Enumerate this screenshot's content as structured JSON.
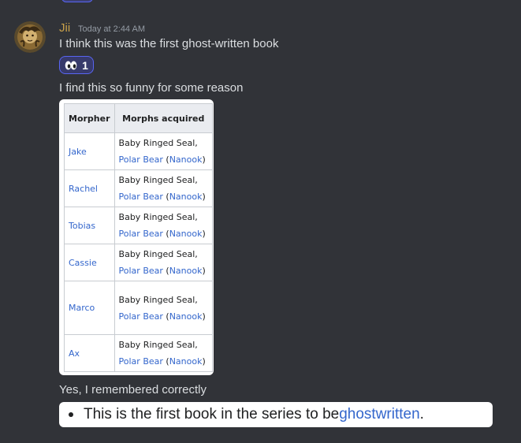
{
  "message": {
    "username": "Jii",
    "timestamp": "Today at 2:44 AM",
    "lines": {
      "first": "I think this was the first ghost-written book",
      "second": "I find this so funny for some reason",
      "third": "Yes, I remembered correctly"
    },
    "reaction": {
      "icon": "eyes-emoji-icon",
      "count": "1"
    }
  },
  "table": {
    "headers": [
      "Morpher",
      "Morphs acquired"
    ],
    "rows": [
      {
        "name": "Jake",
        "morph1": "Baby Ringed Seal,",
        "morph2_link": "Polar Bear",
        "open_paren": " (",
        "nick_link": "Nanook",
        "close_paren": ")"
      },
      {
        "name": "Rachel",
        "morph1": "Baby Ringed Seal,",
        "morph2_link": "Polar Bear",
        "open_paren": " (",
        "nick_link": "Nanook",
        "close_paren": ")"
      },
      {
        "name": "Tobias",
        "morph1": "Baby Ringed Seal,",
        "morph2_link": "Polar Bear",
        "open_paren": " (",
        "nick_link": "Nanook",
        "close_paren": ")"
      },
      {
        "name": "Cassie",
        "morph1": "Baby Ringed Seal,",
        "morph2_link": "Polar Bear",
        "open_paren": " (",
        "nick_link": "Nanook",
        "close_paren": ")"
      },
      {
        "name": "Marco",
        "morph1": "Baby Ringed Seal,",
        "morph2_link": "Polar Bear",
        "open_paren": " (",
        "nick_link": "Nanook",
        "close_paren": ")"
      },
      {
        "name": "Ax",
        "morph1": "Baby Ringed Seal,",
        "morph2_link": "Polar Bear",
        "open_paren": " (",
        "nick_link": "Nanook",
        "close_paren": ")"
      }
    ]
  },
  "quote": {
    "before": "This is the first book in the series to be ",
    "link": "ghostwritten",
    "after": "."
  },
  "colors": {
    "background": "#313338",
    "username": "#c9a14a",
    "text": "#dbdee1",
    "link": "#3366cc",
    "reaction_border": "#5865f2"
  }
}
